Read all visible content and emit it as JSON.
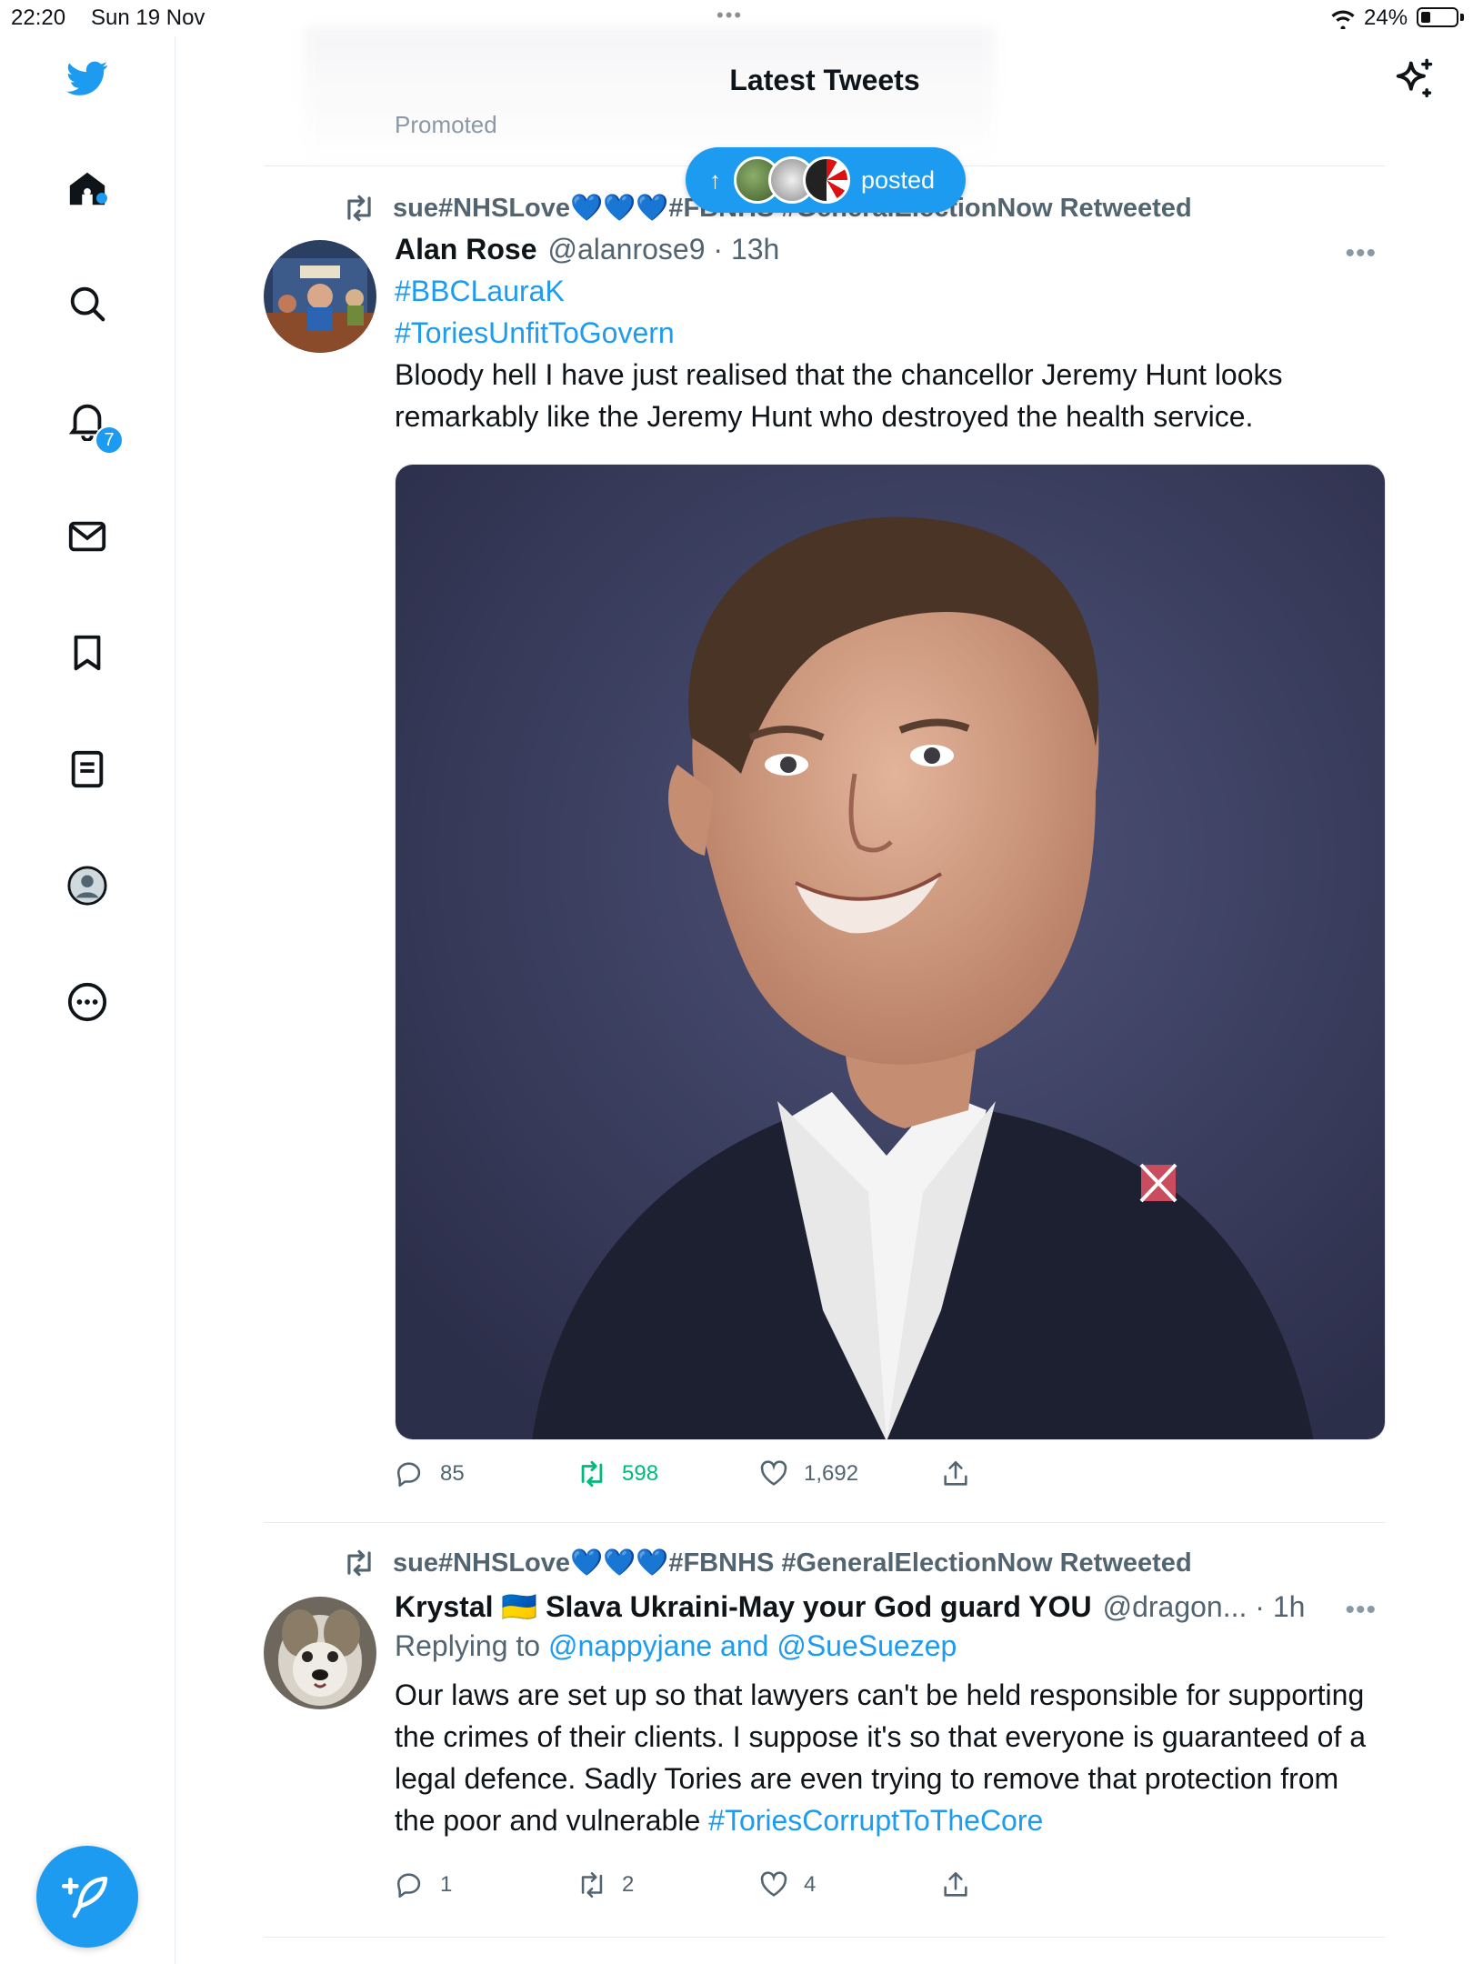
{
  "status_bar": {
    "time": "22:20",
    "date": "Sun 19 Nov",
    "battery": "24%"
  },
  "header": {
    "title": "Latest Tweets",
    "promoted_label": "Promoted"
  },
  "new_posts_pill": {
    "label": "posted"
  },
  "sidebar": {
    "notifications_badge": "7",
    "items": [
      "twitter-logo",
      "home-icon",
      "search-icon",
      "bell-icon",
      "mail-icon",
      "bookmark-icon",
      "list-icon",
      "profile-icon",
      "more-icon"
    ]
  },
  "tweets": [
    {
      "retweeted_by": "sue#NHSLove💙💙💙#FBNHS #GeneralElectionNow Retweeted",
      "name": "Alan Rose",
      "handle": "@alanrose9 · 13h",
      "hashtags": [
        "#BBCLauraK",
        "#ToriesUnfitToGovern"
      ],
      "text": "Bloody hell I have just realised that the chancellor Jeremy Hunt looks remarkably like the Jeremy Hunt who destroyed the health service.",
      "stats": {
        "replies": "85",
        "retweets": "598",
        "likes": "1,692"
      }
    },
    {
      "retweeted_by": "sue#NHSLove💙💙💙#FBNHS #GeneralElectionNow Retweeted",
      "name": "Krystal 🇺🇦 Slava Ukraini-May your God guard YOU",
      "handle": "@dragon... · 1h",
      "replying_prefix": "Replying to",
      "replying_to": "@nappyjane and @SueSuezep",
      "text": "Our laws are set up so that lawyers can't be held responsible for supporting the crimes of their clients. I suppose it's so that everyone is guaranteed of a legal defence. Sadly Tories are even trying to remove that protection from the poor and vulnerable",
      "hashtag": "#ToriesCorruptToTheCore",
      "stats": {
        "replies": "1",
        "retweets": "2",
        "likes": "4"
      }
    }
  ],
  "colors": {
    "accent": "#1d9bf0",
    "retweet_green": "#00ba7c",
    "muted": "#536471"
  }
}
